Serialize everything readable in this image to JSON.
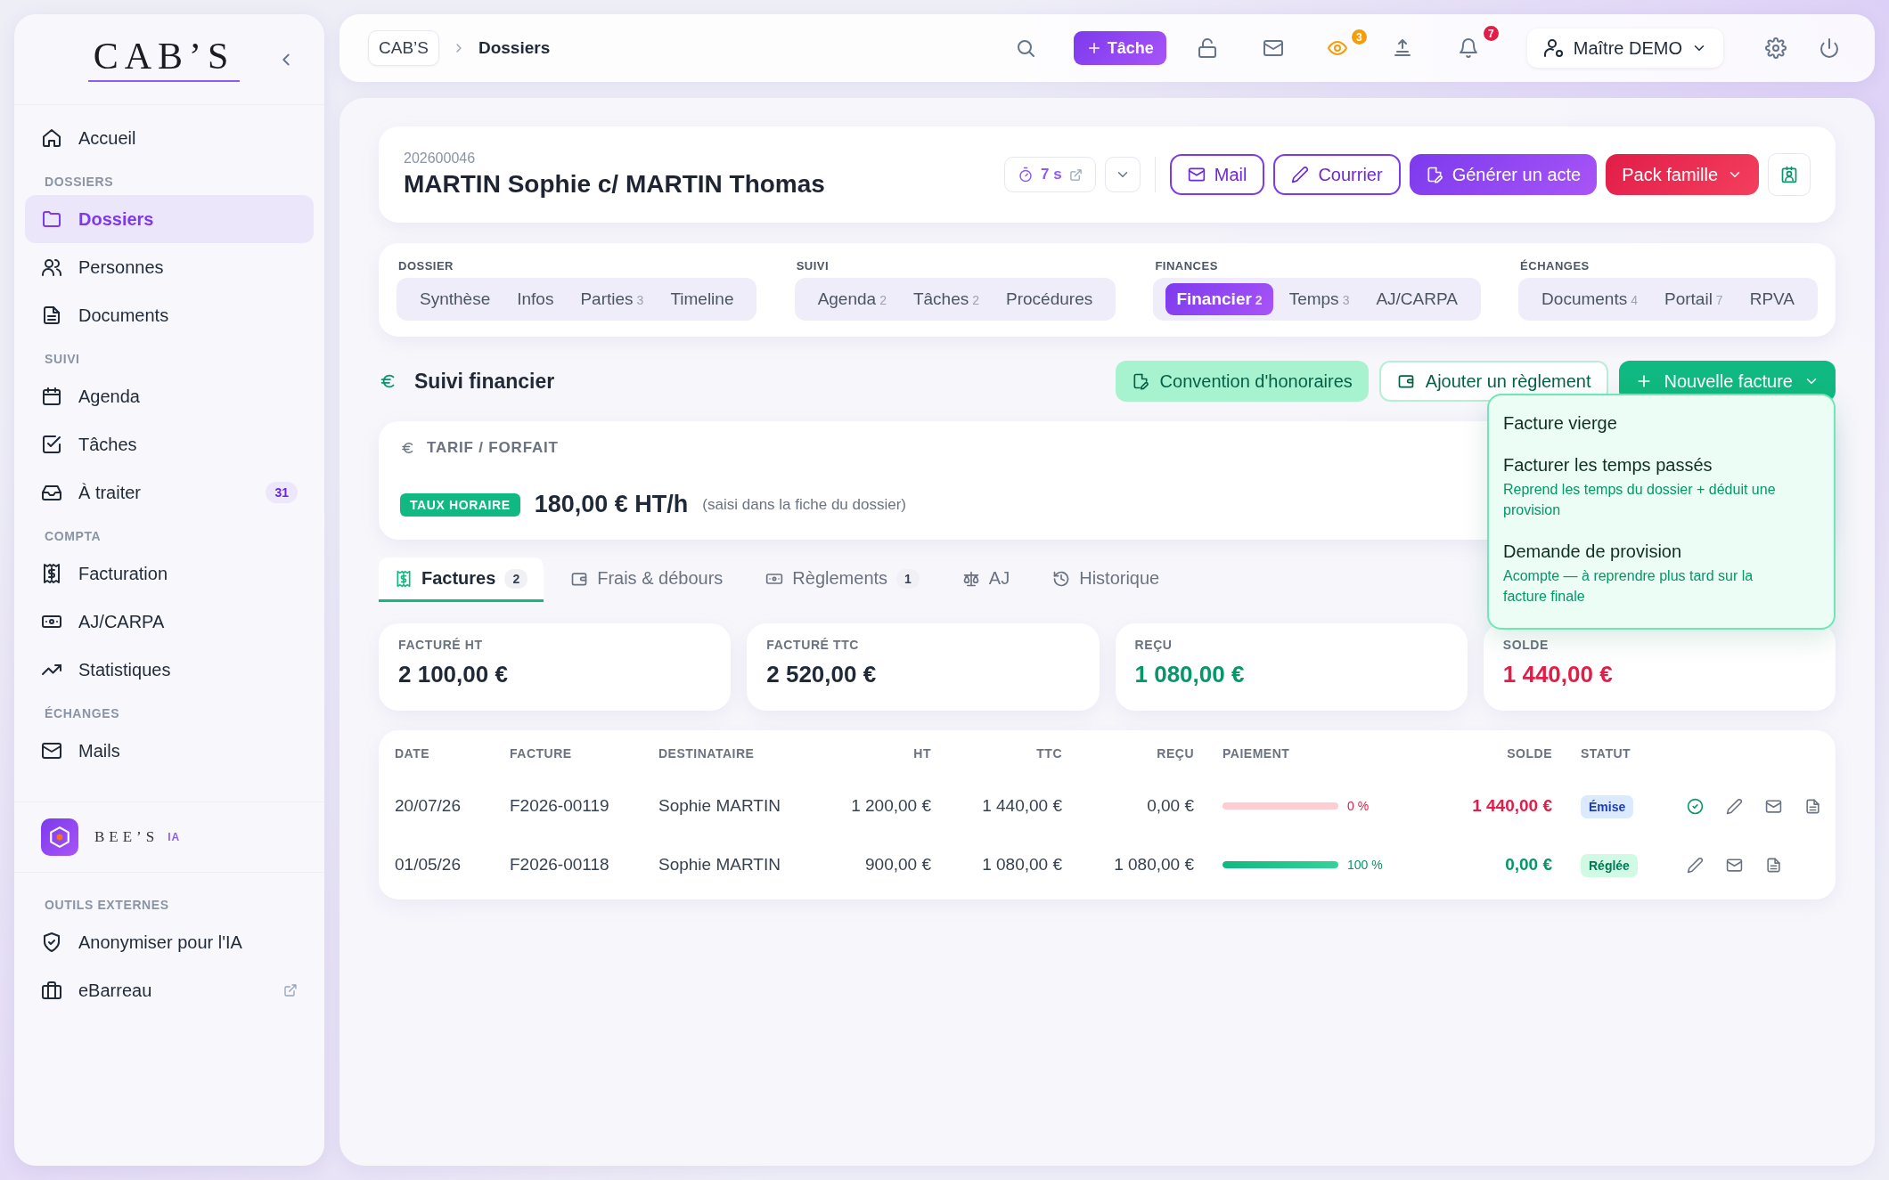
{
  "sidebar": {
    "logo": "CAB’S",
    "sections": [
      {
        "items": [
          {
            "label": "Accueil",
            "selected": false
          }
        ]
      },
      {
        "title": "DOSSIERS",
        "items": [
          {
            "label": "Dossiers",
            "selected": true
          },
          {
            "label": "Personnes",
            "selected": false
          },
          {
            "label": "Documents",
            "selected": false
          }
        ]
      },
      {
        "title": "SUIVI",
        "items": [
          {
            "label": "Agenda",
            "selected": false
          },
          {
            "label": "Tâches",
            "selected": false
          },
          {
            "label": "À traiter",
            "selected": false,
            "badge": "31"
          }
        ]
      },
      {
        "title": "COMPTA",
        "items": [
          {
            "label": "Facturation",
            "selected": false
          },
          {
            "label": "AJ/CARPA",
            "selected": false
          },
          {
            "label": "Statistiques",
            "selected": false
          }
        ]
      },
      {
        "title": "ÉCHANGES",
        "items": [
          {
            "label": "Mails",
            "selected": false
          }
        ]
      }
    ],
    "assistant": {
      "name": "BEE’S",
      "tag": "IA"
    },
    "external": {
      "title": "OUTILS EXTERNES",
      "items": [
        {
          "label": "Anonymiser pour l'IA",
          "external": false
        },
        {
          "label": "eBarreau",
          "external": true
        }
      ]
    }
  },
  "topbar": {
    "breadcrumb": [
      "CAB’S",
      "Dossiers"
    ],
    "tools": [
      {
        "kind": "search",
        "active": false
      },
      {
        "kind": "task",
        "label": "Tâche"
      },
      {
        "kind": "lock",
        "active": false
      },
      {
        "kind": "mail",
        "active": false
      },
      {
        "kind": "eye",
        "active": true,
        "badge": "3",
        "color": "#f59e0b"
      },
      {
        "kind": "upload",
        "active": false
      },
      {
        "kind": "bell",
        "active": false,
        "badge": "7",
        "color": "#e11d48"
      }
    ],
    "user": "Maître DEMO"
  },
  "header": {
    "number": "202600046",
    "title": "MARTIN Sophie c/ MARTIN Thomas",
    "timer": "7 s",
    "actions": [
      {
        "label": "Mail",
        "kind": "outline",
        "menu": false
      },
      {
        "label": "Courrier",
        "kind": "outline",
        "menu": false
      },
      {
        "label": "Générer un acte",
        "kind": "primary",
        "menu": false
      },
      {
        "label": "Pack famille",
        "kind": "danger",
        "menu": true
      }
    ]
  },
  "nav": {
    "groups": [
      {
        "title": "DOSSIER",
        "tabs": [
          {
            "label": "Synthèse",
            "selected": false
          },
          {
            "label": "Infos",
            "selected": false
          },
          {
            "label": "Parties",
            "count": "3",
            "selected": false
          },
          {
            "label": "Timeline",
            "selected": false
          }
        ]
      },
      {
        "title": "SUIVI",
        "tabs": [
          {
            "label": "Agenda",
            "count": "2",
            "selected": false
          },
          {
            "label": "Tâches",
            "count": "2",
            "selected": false
          },
          {
            "label": "Procédures",
            "selected": false
          }
        ]
      },
      {
        "title": "FINANCES",
        "tabs": [
          {
            "label": "Financier",
            "count": "2",
            "selected": true
          },
          {
            "label": "Temps",
            "count": "3",
            "selected": false
          },
          {
            "label": "AJ/CARPA",
            "selected": false
          }
        ]
      },
      {
        "title": "ÉCHANGES",
        "tabs": [
          {
            "label": "Documents",
            "count": "4",
            "selected": false
          },
          {
            "label": "Portail",
            "count": "7",
            "selected": false
          },
          {
            "label": "RPVA",
            "selected": false
          }
        ]
      }
    ]
  },
  "finance": {
    "title": "Suivi financier",
    "actions": [
      {
        "label": "Convention d'honoraires",
        "kind": "soft",
        "menu": false
      },
      {
        "label": "Ajouter un règlement",
        "kind": "outline",
        "menu": false
      },
      {
        "label": "Nouvelle facture",
        "kind": "solid",
        "menu": true
      }
    ],
    "menu": [
      {
        "title": "Facture vierge"
      },
      {
        "title": "Facturer les temps passés",
        "description": "Reprend les temps du dossier + déduit une provision"
      },
      {
        "title": "Demande de provision",
        "description": "Acompte — à reprendre plus tard sur la facture finale"
      }
    ],
    "tarif": {
      "heading": "TARIF / FORFAIT",
      "badge": "TAUX HORAIRE",
      "rate": "180,00 € HT/h",
      "note": "(saisi dans la fiche du dossier)"
    },
    "tabs": [
      {
        "label": "Factures",
        "count": "2",
        "selected": true
      },
      {
        "label": "Frais & débours",
        "selected": false
      },
      {
        "label": "Règlements",
        "count": "1",
        "selected": false
      },
      {
        "label": "AJ",
        "selected": false
      },
      {
        "label": "Historique",
        "selected": false
      }
    ],
    "stats": [
      {
        "label": "FACTURÉ HT",
        "value": "2 100,00 €",
        "kind": "neutral"
      },
      {
        "label": "FACTURÉ TTC",
        "value": "2 520,00 €",
        "kind": "neutral"
      },
      {
        "label": "REÇU",
        "value": "1 080,00 €",
        "kind": "positive"
      },
      {
        "label": "SOLDE",
        "value": "1 440,00 €",
        "kind": "negative"
      }
    ],
    "table": {
      "columns": [
        "DATE",
        "FACTURE",
        "DESTINATAIRE",
        "HT",
        "TTC",
        "REÇU",
        "PAIEMENT",
        "SOLDE",
        "STATUT"
      ],
      "rows": [
        {
          "date": "20/07/26",
          "invoice": "F2026-00119",
          "recipient": "Sophie MARTIN",
          "ht": "1 200,00 €",
          "ttc": "1 440,00 €",
          "received": "0,00 €",
          "level": 0,
          "percent": "0 %",
          "balance": "1 440,00 €",
          "status": {
            "label": "Émise",
            "kind": "issued"
          },
          "validatable": true
        },
        {
          "date": "01/05/26",
          "invoice": "F2026-00118",
          "recipient": "Sophie MARTIN",
          "ht": "900,00 €",
          "ttc": "1 080,00 €",
          "received": "1 080,00 €",
          "level": 1,
          "percent": "100 %",
          "balance": "0,00 €",
          "status": {
            "label": "Réglée",
            "kind": "settled"
          },
          "validatable": false
        }
      ]
    }
  }
}
